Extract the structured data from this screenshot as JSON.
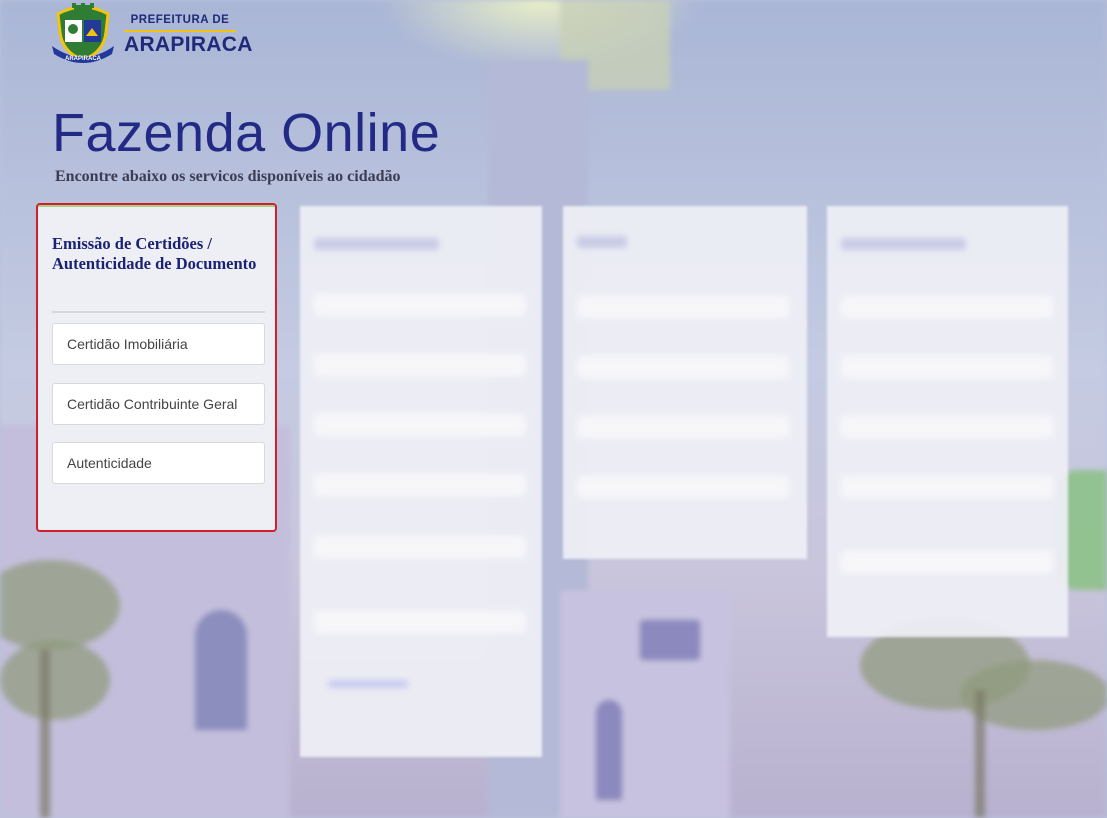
{
  "header": {
    "brand_prefix": "PREFEITURA DE",
    "brand_city": "ARAPIRACA",
    "seal_text": "ARAPIRACA"
  },
  "page": {
    "title": "Fazenda Online",
    "subtitle": "Encontre abaixo os servicos disponíveis ao cidadão"
  },
  "service_card": {
    "title": "Emissão de Certidões / Autenticidade de Documento",
    "buttons": [
      {
        "label": "Certidão Imobiliária"
      },
      {
        "label": "Certidão Contribuinte Geral"
      },
      {
        "label": "Autenticidade"
      }
    ]
  },
  "colors": {
    "title_blue": "#232a86",
    "highlight_border": "#d0202c",
    "brand_yellow": "#f1c40f"
  }
}
